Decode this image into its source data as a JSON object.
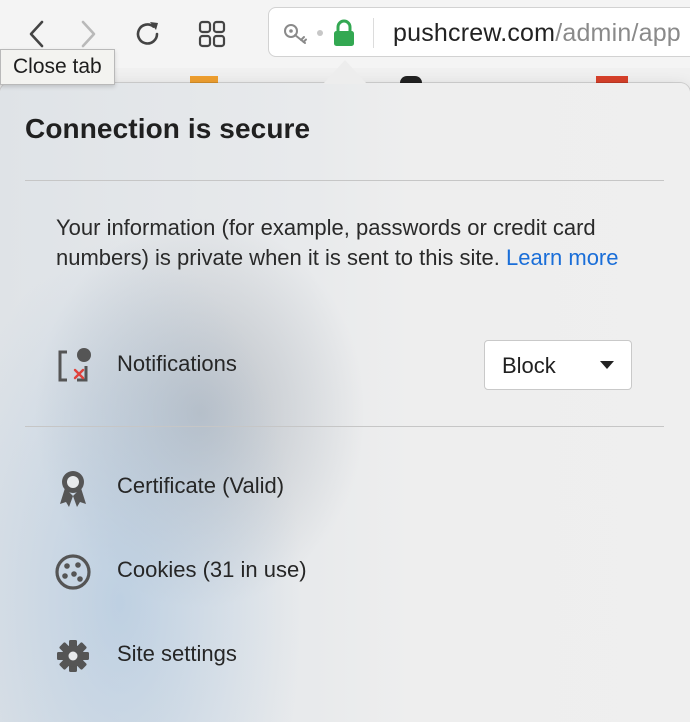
{
  "toolbar": {
    "url_host": "pushcrew.com",
    "url_path": "/admin/app"
  },
  "tooltip": {
    "text": "Close tab"
  },
  "popup": {
    "title": "Connection is secure",
    "description": "Your information (for example, passwords or credit card numbers) is private when it is sent to this site.",
    "learn_more": "Learn more",
    "notifications": {
      "label": "Notifications",
      "selected": "Block"
    },
    "items": [
      {
        "label": "Certificate (Valid)",
        "icon": "certificate-icon"
      },
      {
        "label": "Cookies (31 in use)",
        "icon": "cookie-icon"
      },
      {
        "label": "Site settings",
        "icon": "gear-icon"
      }
    ]
  },
  "colors": {
    "lock_green": "#33a852",
    "link_blue": "#1a6ed8",
    "notification_blocked_red": "#e0423c"
  }
}
